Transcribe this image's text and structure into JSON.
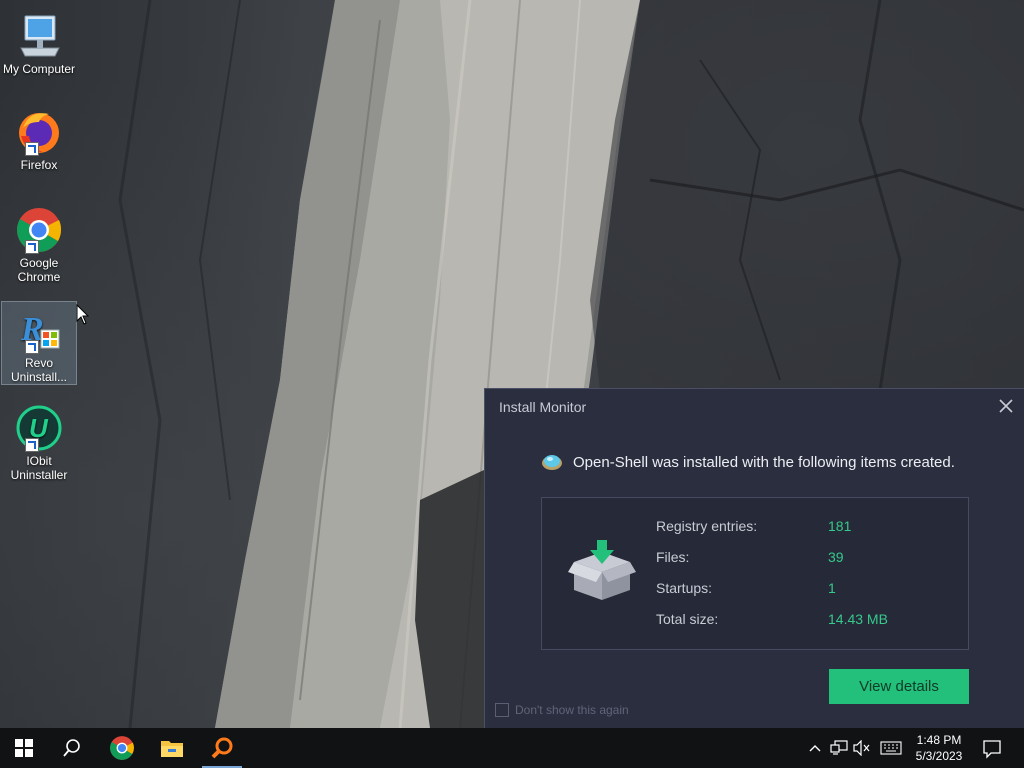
{
  "desktop": {
    "icons": [
      {
        "label": "My Computer",
        "icon": "computer-icon"
      },
      {
        "label": "Firefox",
        "icon": "firefox-icon"
      },
      {
        "label": "Google Chrome",
        "icon": "chrome-icon"
      },
      {
        "label": "Revo Uninstall...",
        "icon": "revo-uninstaller-icon"
      },
      {
        "label": "IObit Uninstaller",
        "icon": "iobit-uninstaller-icon"
      }
    ]
  },
  "dialog": {
    "title": "Install Monitor",
    "headline": "Open-Shell was installed with the following items created.",
    "stats": [
      {
        "label": "Registry entries:",
        "value": "181"
      },
      {
        "label": "Files:",
        "value": "39"
      },
      {
        "label": "Startups:",
        "value": "1"
      },
      {
        "label": "Total size:",
        "value": "14.43 MB"
      }
    ],
    "view_details_label": "View details",
    "dont_show_label": "Don't show this again",
    "dont_show_checked": false,
    "accent_color": "#22c07a",
    "value_color": "#36c98b"
  },
  "taskbar": {
    "apps": [
      "start-icon",
      "search-icon",
      "chrome-icon",
      "file-explorer-icon",
      "revo-uninstaller-icon"
    ],
    "time": "1:48 PM",
    "date": "5/3/2023",
    "tray": [
      "chevron-up-icon",
      "network-icon",
      "volume-muted-icon",
      "keyboard-icon",
      "notification-icon"
    ]
  }
}
